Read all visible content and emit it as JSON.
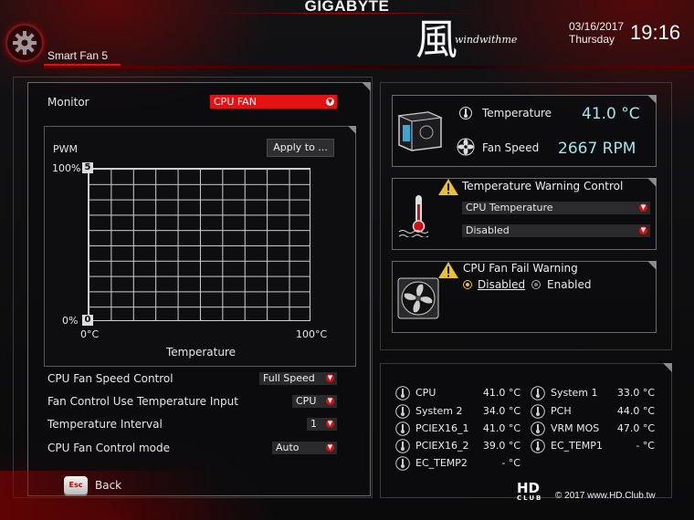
{
  "header": {
    "brand": "GIGABYTE",
    "logo_glyph": "風",
    "logo_text": "windwithme",
    "date": "03/16/2017",
    "weekday": "Thursday",
    "time": "19:16",
    "page_title": "Smart Fan 5"
  },
  "left": {
    "monitor_label": "Monitor",
    "monitor_value": "CPU FAN",
    "chart": {
      "pwm_label": "PWM",
      "apply_label": "Apply to ...",
      "y_top": "100%",
      "y_bottom": "0%",
      "point_top": "5",
      "point_bottom": "0",
      "x_left": "0°C",
      "x_right": "100°C",
      "x_title": "Temperature"
    },
    "settings": [
      {
        "label": "CPU Fan Speed Control",
        "value": "Full Speed"
      },
      {
        "label": "Fan Control Use Temperature Input",
        "value": "CPU"
      },
      {
        "label": "Temperature Interval",
        "value": "1"
      },
      {
        "label": "CPU Fan Control mode",
        "value": "Auto"
      }
    ],
    "back_key": "Esc",
    "back_label": "Back"
  },
  "right": {
    "monitor": {
      "temp_label": "Temperature",
      "temp_value": "41.0 °C",
      "fan_label": "Fan Speed",
      "fan_value": "2667 RPM"
    },
    "temp_warning": {
      "title": "Temperature Warning Control",
      "source": "CPU Temperature",
      "state": "Disabled"
    },
    "fan_fail": {
      "title": "CPU Fan Fail Warning",
      "option_disabled": "Disabled",
      "option_enabled": "Enabled",
      "selected": "Disabled"
    },
    "temps": [
      {
        "name": "CPU",
        "value": "41.0 °C"
      },
      {
        "name": "System 2",
        "value": "34.0 °C"
      },
      {
        "name": "PCIEX16_1",
        "value": "41.0 °C"
      },
      {
        "name": "PCIEX16_2",
        "value": "39.0 °C"
      },
      {
        "name": "EC_TEMP2",
        "value": "- °C"
      },
      {
        "name": "System 1",
        "value": "33.0 °C"
      },
      {
        "name": "PCH",
        "value": "44.0 °C"
      },
      {
        "name": "VRM MOS",
        "value": "47.0 °C"
      },
      {
        "name": "EC_TEMP1",
        "value": "- °C"
      }
    ]
  },
  "watermark": {
    "logo_top": "HD",
    "logo_bottom": "CLUB",
    "text": "© 2017 www.HD.Club.tw"
  },
  "colors": {
    "accent_red": "#e41212",
    "value_cyan": "#a6e3ea",
    "warning_yellow": "#e8c030"
  }
}
